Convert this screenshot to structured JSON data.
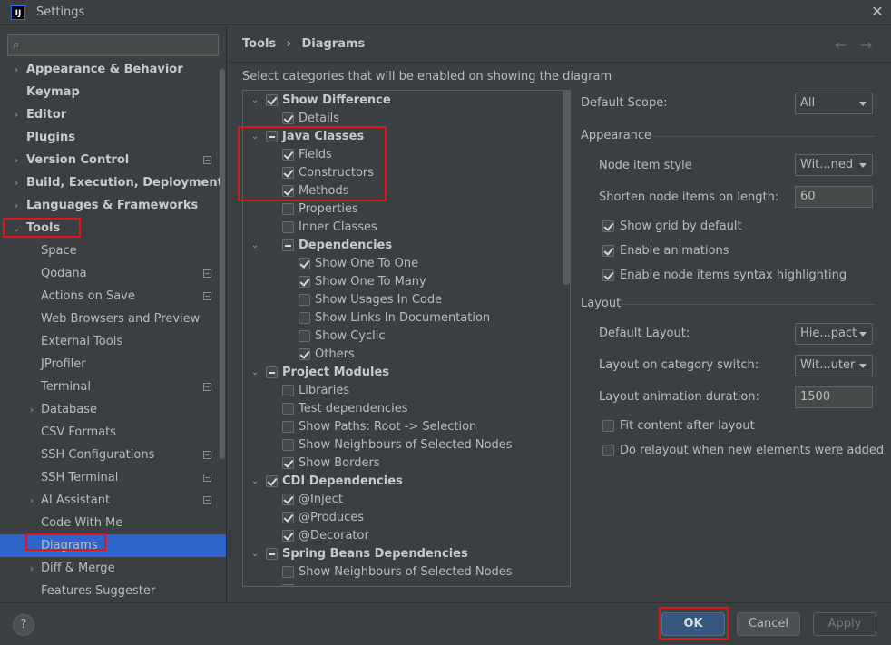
{
  "window": {
    "title": "Settings",
    "app_icon": "IJ"
  },
  "search": {
    "placeholder": ""
  },
  "sidebar": {
    "items": [
      {
        "label": "Appearance & Behavior",
        "arrow": "›",
        "bold": true,
        "badge": false
      },
      {
        "label": "Keymap",
        "arrow": "",
        "bold": true,
        "badge": false
      },
      {
        "label": "Editor",
        "arrow": "›",
        "bold": true,
        "badge": false
      },
      {
        "label": "Plugins",
        "arrow": "",
        "bold": true,
        "badge": false
      },
      {
        "label": "Version Control",
        "arrow": "›",
        "bold": true,
        "badge": true
      },
      {
        "label": "Build, Execution, Deployment",
        "arrow": "›",
        "bold": true,
        "badge": false
      },
      {
        "label": "Languages & Frameworks",
        "arrow": "›",
        "bold": true,
        "badge": false
      },
      {
        "label": "Tools",
        "arrow": "⌄",
        "bold": true,
        "badge": false
      },
      {
        "label": "Space",
        "arrow": "",
        "bold": false,
        "badge": false
      },
      {
        "label": "Qodana",
        "arrow": "",
        "bold": false,
        "badge": true
      },
      {
        "label": "Actions on Save",
        "arrow": "",
        "bold": false,
        "badge": true
      },
      {
        "label": "Web Browsers and Preview",
        "arrow": "",
        "bold": false,
        "badge": false
      },
      {
        "label": "External Tools",
        "arrow": "",
        "bold": false,
        "badge": false
      },
      {
        "label": "JProfiler",
        "arrow": "",
        "bold": false,
        "badge": false
      },
      {
        "label": "Terminal",
        "arrow": "",
        "bold": false,
        "badge": true
      },
      {
        "label": "Database",
        "arrow": "›",
        "bold": false,
        "badge": false
      },
      {
        "label": "CSV Formats",
        "arrow": "",
        "bold": false,
        "badge": false
      },
      {
        "label": "SSH Configurations",
        "arrow": "",
        "bold": false,
        "badge": true
      },
      {
        "label": "SSH Terminal",
        "arrow": "",
        "bold": false,
        "badge": true
      },
      {
        "label": "AI Assistant",
        "arrow": "›",
        "bold": false,
        "badge": true
      },
      {
        "label": "Code With Me",
        "arrow": "",
        "bold": false,
        "badge": false
      },
      {
        "label": "Diagrams",
        "arrow": "",
        "bold": false,
        "badge": false,
        "selected": true
      },
      {
        "label": "Diff & Merge",
        "arrow": "›",
        "bold": false,
        "badge": false
      },
      {
        "label": "Features Suggester",
        "arrow": "",
        "bold": false,
        "badge": false
      }
    ]
  },
  "header": {
    "crumb_parent": "Tools",
    "crumb_sep": "›",
    "crumb_current": "Diagrams",
    "back_icon": "arrow-left-icon",
    "forward_icon": "arrow-right-icon"
  },
  "categories": {
    "caption": "Select categories that will be enabled on showing the diagram",
    "rows": [
      {
        "label": "Show Difference",
        "level": 0,
        "arrow": "⌄",
        "state": "on",
        "bold": true
      },
      {
        "label": "Details",
        "level": 1,
        "arrow": "",
        "state": "on",
        "bold": false
      },
      {
        "label": "Java Classes",
        "level": 0,
        "arrow": "⌄",
        "state": "part",
        "bold": true
      },
      {
        "label": "Fields",
        "level": 1,
        "arrow": "",
        "state": "on",
        "bold": false
      },
      {
        "label": "Constructors",
        "level": 1,
        "arrow": "",
        "state": "on",
        "bold": false
      },
      {
        "label": "Methods",
        "level": 1,
        "arrow": "",
        "state": "on",
        "bold": false
      },
      {
        "label": "Properties",
        "level": 1,
        "arrow": "",
        "state": "off",
        "bold": false
      },
      {
        "label": "Inner Classes",
        "level": 1,
        "arrow": "",
        "state": "off",
        "bold": false
      },
      {
        "label": "Dependencies",
        "level": 1,
        "arrow": "⌄",
        "state": "part",
        "bold": true
      },
      {
        "label": "Show One To One",
        "level": 2,
        "arrow": "",
        "state": "on",
        "bold": false
      },
      {
        "label": "Show One To Many",
        "level": 2,
        "arrow": "",
        "state": "on",
        "bold": false
      },
      {
        "label": "Show Usages In Code",
        "level": 2,
        "arrow": "",
        "state": "off",
        "bold": false
      },
      {
        "label": "Show Links In Documentation",
        "level": 2,
        "arrow": "",
        "state": "off",
        "bold": false
      },
      {
        "label": "Show Cyclic",
        "level": 2,
        "arrow": "",
        "state": "off",
        "bold": false
      },
      {
        "label": "Others",
        "level": 2,
        "arrow": "",
        "state": "on",
        "bold": false
      },
      {
        "label": "Project Modules",
        "level": 0,
        "arrow": "⌄",
        "state": "part",
        "bold": true
      },
      {
        "label": "Libraries",
        "level": 1,
        "arrow": "",
        "state": "off",
        "bold": false
      },
      {
        "label": "Test dependencies",
        "level": 1,
        "arrow": "",
        "state": "off",
        "bold": false
      },
      {
        "label": "Show Paths: Root -> Selection",
        "level": 1,
        "arrow": "",
        "state": "off",
        "bold": false
      },
      {
        "label": "Show Neighbours of Selected Nodes",
        "level": 1,
        "arrow": "",
        "state": "off",
        "bold": false
      },
      {
        "label": "Show Borders",
        "level": 1,
        "arrow": "",
        "state": "on",
        "bold": false
      },
      {
        "label": "CDI Dependencies",
        "level": 0,
        "arrow": "⌄",
        "state": "on",
        "bold": true
      },
      {
        "label": "@Inject",
        "level": 1,
        "arrow": "",
        "state": "on",
        "bold": false
      },
      {
        "label": "@Produces",
        "level": 1,
        "arrow": "",
        "state": "on",
        "bold": false
      },
      {
        "label": "@Decorator",
        "level": 1,
        "arrow": "",
        "state": "on",
        "bold": false
      },
      {
        "label": "Spring Beans Dependencies",
        "level": 0,
        "arrow": "⌄",
        "state": "part",
        "bold": true
      },
      {
        "label": "Show Neighbours of Selected Nodes",
        "level": 1,
        "arrow": "",
        "state": "off",
        "bold": false
      },
      {
        "label": "",
        "level": 1,
        "arrow": "",
        "state": "on",
        "bold": false
      }
    ]
  },
  "settings": {
    "default_scope_label": "Default Scope:",
    "default_scope_value": "All",
    "appearance_title": "Appearance",
    "node_item_style_label": "Node item style",
    "node_item_style_value": "Wit...ned",
    "shorten_label": "Shorten node items on length:",
    "shorten_value": "60",
    "show_grid_label": "Show grid by default",
    "show_grid_checked": true,
    "enable_animations_label": "Enable animations",
    "enable_animations_checked": true,
    "syntax_highlight_label": "Enable node items syntax highlighting",
    "syntax_highlight_checked": true,
    "layout_title": "Layout",
    "default_layout_label": "Default Layout:",
    "default_layout_value": "Hie...pact",
    "layout_switch_label": "Layout on category switch:",
    "layout_switch_value": "Wit...uter",
    "anim_duration_label": "Layout animation duration:",
    "anim_duration_value": "1500",
    "fit_content_label": "Fit content after layout",
    "fit_content_checked": false,
    "relayout_label": "Do relayout when new elements were added",
    "relayout_checked": false
  },
  "footer": {
    "help": "?",
    "ok": "OK",
    "cancel": "Cancel",
    "apply": "Apply"
  },
  "colors": {
    "highlight_red": "#e0151b",
    "selection_blue": "#2f65ca",
    "ok_blue": "#365880"
  }
}
